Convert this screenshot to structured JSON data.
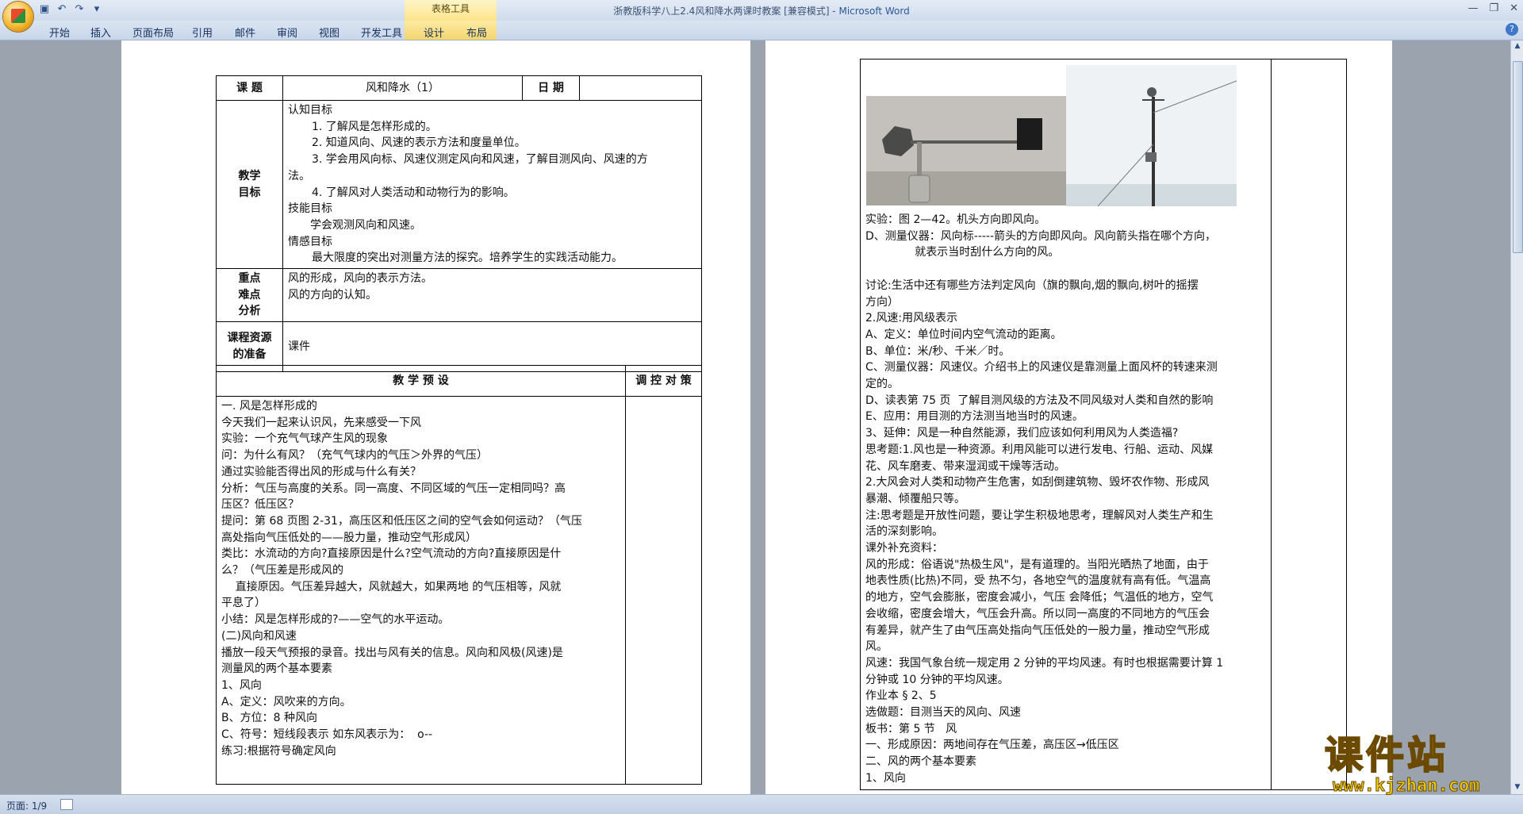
{
  "window": {
    "title": "浙教版科学八上2.4风和降水两课时教案 [兼容模式] - ",
    "app_name": "Microsoft Word",
    "context_tab": "表格工具"
  },
  "ribbon": {
    "tabs": [
      "开始",
      "插入",
      "页面布局",
      "引用",
      "邮件",
      "审阅",
      "视图",
      "开发工具",
      "设计",
      "布局"
    ]
  },
  "status": {
    "page": "页面: 1/9"
  },
  "page1": {
    "header": {
      "topic_label": "课  题",
      "topic_value": "风和降水（1）",
      "date_label": "日 期"
    },
    "goals_label": [
      "教学",
      "目标"
    ],
    "goals_lines": [
      "认知目标",
      "1. 了解风是怎样形成的。",
      "2. 知道风向、风速的表示方法和度量单位。",
      "3. 学会用风向标、风速仪测定风向和风速，了解目测风向、风速的方",
      "法。",
      "4. 了解风对人类活动和动物行为的影响。",
      "技能目标",
      "学会观测风向和风速。",
      "情感目标",
      "最大限度的突出对测量方法的探究。培养学生的实践活动能力。"
    ],
    "focus_label": [
      "重点",
      "难点",
      "分析"
    ],
    "focus_lines": [
      "风的形成，风向的表示方法。",
      "风的方向的认知。"
    ],
    "resource_label": [
      "课程资源",
      "的准备"
    ],
    "resource_value": "课件",
    "preset_label": "教     学     预     设",
    "control_label": "调 控 对 策",
    "body_lines": [
      "一. 风是怎样形成的",
      "今天我们一起来认识风，先来感受一下风",
      "实验：一个充气气球产生风的现象",
      "问：为什么有风？（充气气球内的气压＞外界的气压）",
      "通过实验能否得出风的形成与什么有关？",
      "分析：气压与高度的关系。同一高度、不同区域的气压一定相同吗？高",
      "压区？低压区？",
      "提问：第 68 页图 2-31，高压区和低压区之间的空气会如何运动？（气压",
      "高处指向气压低处的——股力量，推动空气形成风）",
      "类比：水流动的方向?直接原因是什么?空气流动的方向?直接原因是什",
      "么？（气压差是形成风的",
      "    直接原因。气压差异越大，风就越大，如果两地 的气压相等，风就",
      "平息了）",
      "小结：风是怎样形成的?——空气的水平运动。",
      "(二)风向和风速",
      "播放一段天气预报的录音。找出与风有关的信息。风向和风极(风速)是",
      "测量风的两个基本要素",
      "1、风向",
      "A、定义：风吹来的方向。",
      "B、方位：8 种风向",
      "C、符号：短线段表示 如东风表示为：  o--",
      "练习:根据符号确定风向"
    ]
  },
  "page2": {
    "lines": [
      "实验：图 2—42。机头方向即风向。",
      "D、测量仪器：风向标-----箭头的方向即风向。风向箭头指在哪个方向，",
      "              就表示当时刮什么方向的风。",
      "",
      "讨论:生活中还有哪些方法判定风向（旗的飘向,烟的飘向,树叶的摇摆",
      "方向）",
      "2.风速:用风级表示",
      "A、定义：单位时间内空气流动的距离。",
      "B、单位：米/秒、千米／时。",
      "C、测量仪器：风速仪。介绍书上的风速仪是靠测量上面风杯的转速来测",
      "定的。",
      "D、读表第 75 页  了解目测风级的方法及不同风级对人类和自然的影响",
      "E、应用：用目测的方法测当地当时的风速。",
      "3、延伸：风是一种自然能源，我们应该如何利用风为人类造福?",
      "思考题:1.风也是一种资源。利用风能可以进行发电、行船、运动、风媒",
      "花、风车磨麦、带来湿润或干燥等活动。",
      "2.大风会对人类和动物产生危害，如刮倒建筑物、毁坏农作物、形成风",
      "暴潮、倾覆船只等。",
      "注:思考题是开放性问题，要让学生积极地思考，理解风对人类生产和生",
      "活的深刻影响。",
      "课外补充资料：",
      "风的形成：俗语说\"热极生风\"，是有道理的。当阳光晒热了地面，由于",
      "地表性质(比热)不同，受 热不匀，各地空气的温度就有高有低。气温高",
      "的地方，空气会膨胀，密度会减小，气压 会降低；气温低的地方，空气",
      "会收缩，密度会增大，气压会升高。所以同一高度的不同地方的气压会",
      "有差异，就产生了由气压高处指向气压低处的一股力量，推动空气形成",
      "风。",
      "风速：我国气象台统一规定用 2 分钟的平均风速。有时也根据需要计算 1",
      "分钟或 10 分钟的平均风速。",
      "作业本 § 2、5",
      "选做题：目测当天的风向、风速",
      "板书：第 5 节   风",
      "一、形成原因：两地间存在气压差，高压区→低压区",
      "二、风的两个基本要素",
      "1、风向"
    ]
  },
  "watermark": {
    "text": "课件站",
    "url": "www.kjzhan.com"
  }
}
